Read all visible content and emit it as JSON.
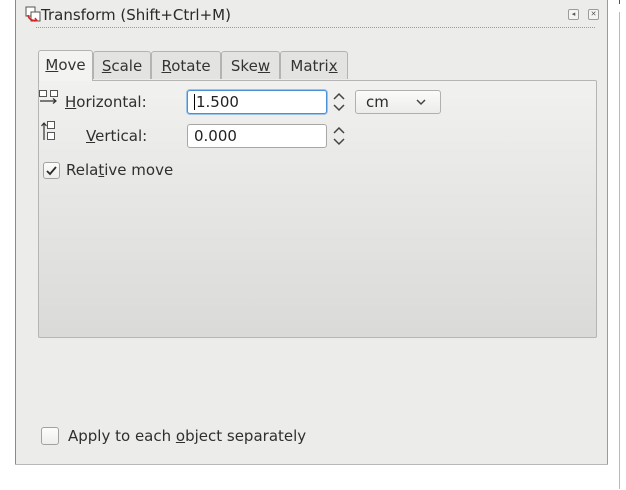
{
  "dialog": {
    "title": "Transform (Shift+Ctrl+M)",
    "icons": {
      "title": "transform-icon",
      "restore": "restore-icon",
      "close": "close-icon"
    }
  },
  "tabs": [
    {
      "label": "Move",
      "active": true
    },
    {
      "label": "Scale",
      "active": false
    },
    {
      "label": "Rotate",
      "active": false
    },
    {
      "label": "Skew",
      "active": false
    },
    {
      "label": "Matrix",
      "active": false
    }
  ],
  "move": {
    "horizontal": {
      "label": "Horizontal:",
      "value": "1.500",
      "icon": "horizontal-move-icon"
    },
    "vertical": {
      "label": "Vertical:",
      "value": "0.000",
      "icon": "vertical-move-icon"
    },
    "unit": "cm",
    "relative_move": {
      "label": "Relative move",
      "checked": true
    }
  },
  "apply_separately": {
    "label": "Apply to each object separately",
    "checked": false
  },
  "colors": {
    "focus": "#4a90d9",
    "background": "#ececea"
  }
}
